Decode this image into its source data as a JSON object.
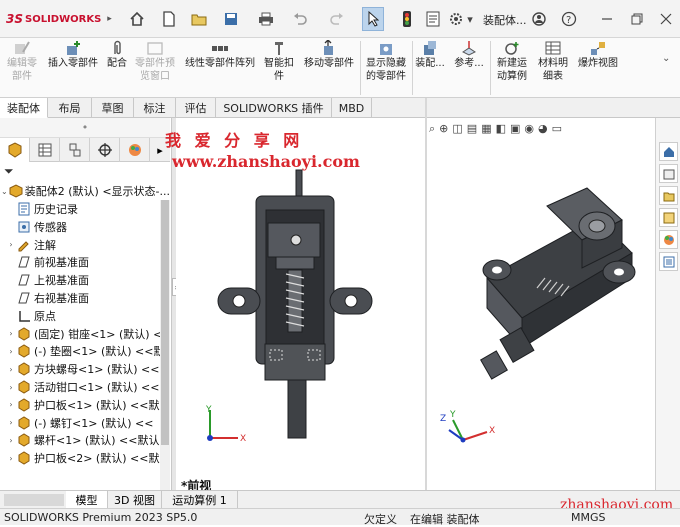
{
  "titlebar": {
    "logo_ds": "3S",
    "logo_text": "SOLIDWORKS",
    "doc_title": "装配体..."
  },
  "ribbon": {
    "items": [
      {
        "label": "编辑零\n部件",
        "disabled": true
      },
      {
        "label": "插入零部件",
        "disabled": false
      },
      {
        "label": "配合",
        "disabled": false
      },
      {
        "label": "零部件预\n览窗口",
        "disabled": true
      },
      {
        "label": "线性零部件阵列",
        "disabled": false
      },
      {
        "label": "智能扣\n件",
        "disabled": false
      },
      {
        "label": "移动零部件",
        "disabled": false
      },
      {
        "label": "显示隐藏\n的零部件",
        "disabled": false
      },
      {
        "label": "装配...",
        "disabled": false
      },
      {
        "label": "参考...",
        "disabled": false
      },
      {
        "label": "新建运\n动算例",
        "disabled": false
      },
      {
        "label": "材料明\n细表",
        "disabled": false
      },
      {
        "label": "爆炸视图",
        "disabled": false
      }
    ]
  },
  "tabs": [
    "装配体",
    "布局",
    "草图",
    "标注",
    "评估",
    "SOLIDWORKS 插件",
    "MBD"
  ],
  "tree": {
    "root": "装配体2 (默认) <显示状态-...",
    "items": [
      {
        "label": "历史记录",
        "icon": "history-icon",
        "arrow": false
      },
      {
        "label": "传感器",
        "icon": "sensor-icon",
        "arrow": false
      },
      {
        "label": "注解",
        "icon": "annotation-icon",
        "arrow": true
      },
      {
        "label": "前视基准面",
        "icon": "plane-icon",
        "arrow": false
      },
      {
        "label": "上视基准面",
        "icon": "plane-icon",
        "arrow": false
      },
      {
        "label": "右视基准面",
        "icon": "plane-icon",
        "arrow": false
      },
      {
        "label": "原点",
        "icon": "origin-icon",
        "arrow": false
      },
      {
        "label": "(固定) 钳座<1> (默认) <",
        "icon": "part-icon",
        "arrow": true
      },
      {
        "label": "(-) 垫圈<1> (默认) <<默",
        "icon": "part-icon",
        "arrow": true
      },
      {
        "label": "方块螺母<1> (默认) <<",
        "icon": "part-icon",
        "arrow": true
      },
      {
        "label": "活动钳口<1> (默认) <<",
        "icon": "part-icon",
        "arrow": true
      },
      {
        "label": "护口板<1> (默认) <<默",
        "icon": "part-icon",
        "arrow": true
      },
      {
        "label": "(-) 螺钉<1> (默认) <<",
        "icon": "part-icon",
        "arrow": true
      },
      {
        "label": "螺杆<1> (默认) <<默认",
        "icon": "part-icon",
        "arrow": true
      },
      {
        "label": "护口板<2> (默认) <<默",
        "icon": "part-icon",
        "arrow": true
      }
    ]
  },
  "viewport": {
    "watermark": "我 爱 分 享 网",
    "watermark_url": "www.zhanshaoyi.com",
    "view_label": "*前视",
    "axis_x": "X",
    "axis_y": "Y",
    "axis_z": "Z"
  },
  "bottom_tabs": [
    "模型",
    "3D 视图",
    "运动算例 1"
  ],
  "status": {
    "version": "SOLIDWORKS Premium 2023 SP5.0",
    "underdefined": "欠定义",
    "editing": "在编辑 装配体",
    "units": "MMGS",
    "watermark": "zhanshaoyi.com"
  },
  "colors": {
    "brand_red": "#c8102e",
    "model_gray": "#4a4d52",
    "watermark_red": "#d9272e"
  }
}
